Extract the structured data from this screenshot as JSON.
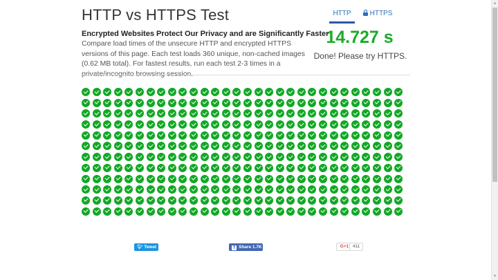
{
  "page": {
    "title": "HTTP vs HTTPS Test",
    "subtitle": "Encrypted Websites Protect Our Privacy and are Significantly Faster",
    "description": "Compare load times of the unsecure HTTP and encrypted HTTPS versions of this page. Each test loads 360 unique, non-cached images (0.62 MB total). For fastest results, run each test 2-3 times in a private/incognito browsing session."
  },
  "tabs": {
    "http": "HTTP",
    "https": "HTTPS",
    "active": "HTTP"
  },
  "result": {
    "time": "14.727 s",
    "status": "Done! Please try HTTPS."
  },
  "grid": {
    "rows": 12,
    "cols": 30,
    "icon": "check-circle-icon",
    "color": "#12a826"
  },
  "social": {
    "tweet_label": "Tweet",
    "share_label": "Share",
    "share_count": "1.7K",
    "gplus_label": "G+1",
    "gplus_count": "411"
  },
  "colors": {
    "accent": "#2a56a8",
    "success": "#1aab29",
    "twitter": "#1b95e0",
    "facebook": "#4267b2"
  }
}
